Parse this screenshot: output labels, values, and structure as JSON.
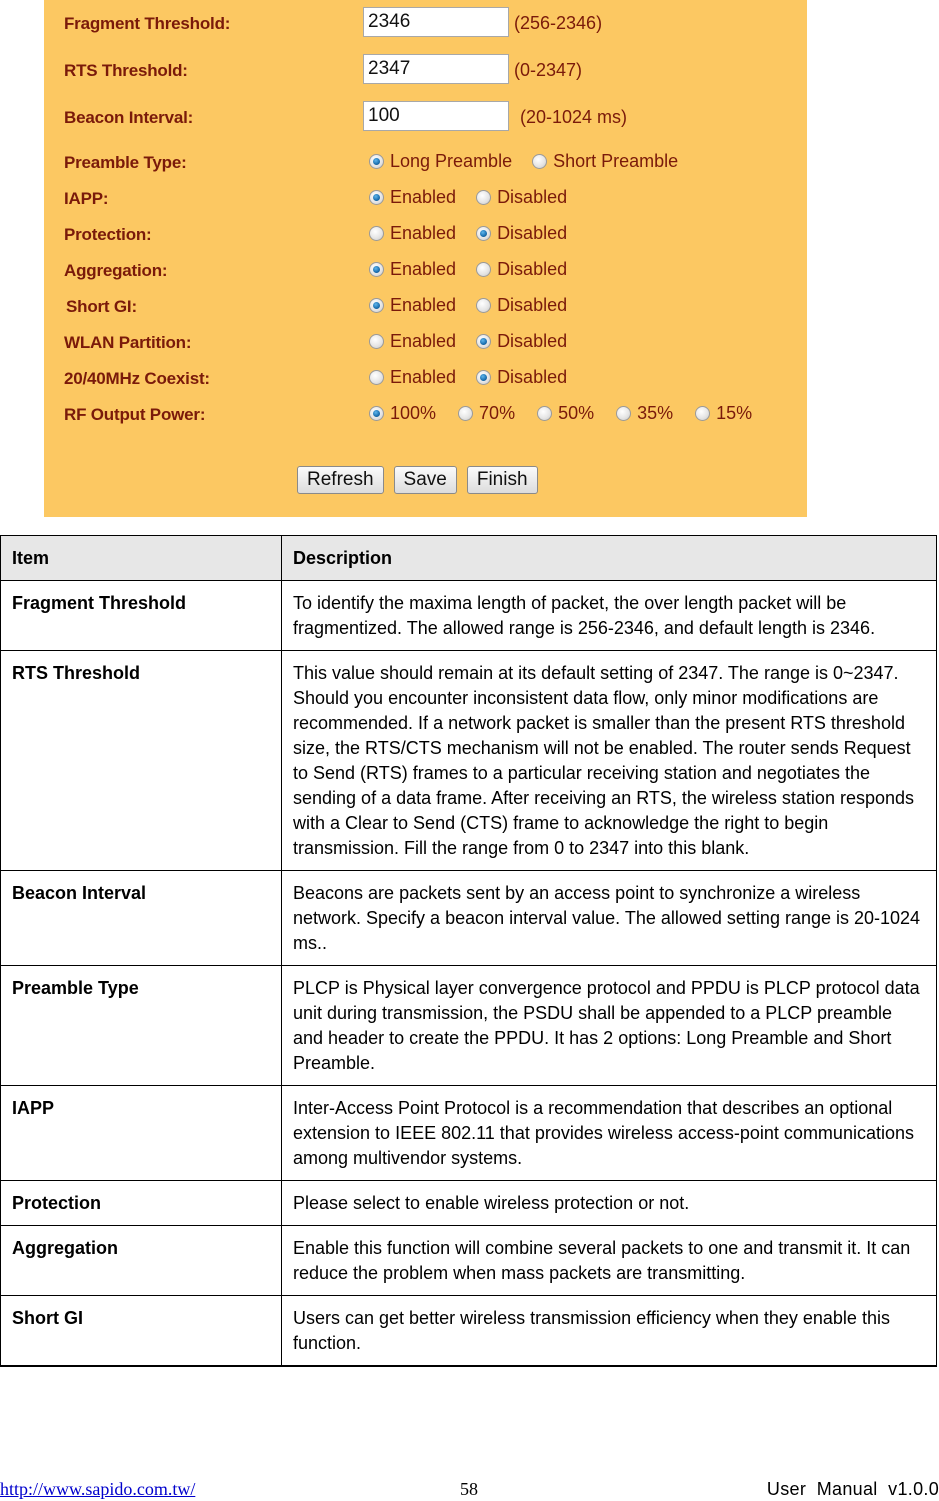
{
  "panel": {
    "background": "#fcc862",
    "text_fields": [
      {
        "label": "Fragment Threshold:",
        "value": "2346",
        "range": "(256-2346)"
      },
      {
        "label": "RTS Threshold:",
        "value": "2347",
        "range": "(0-2347)"
      },
      {
        "label": "Beacon Interval:",
        "value": "100",
        "range": "(20-1024 ms)"
      }
    ],
    "radio_groups": [
      {
        "label": "Preamble Type:",
        "options": [
          "Long Preamble",
          "Short Preamble"
        ],
        "selected": "Long Preamble"
      },
      {
        "label": "IAPP:",
        "options": [
          "Enabled",
          "Disabled"
        ],
        "selected": "Enabled"
      },
      {
        "label": "Protection:",
        "options": [
          "Enabled",
          "Disabled"
        ],
        "selected": "Disabled"
      },
      {
        "label": "Aggregation:",
        "options": [
          "Enabled",
          "Disabled"
        ],
        "selected": "Enabled"
      },
      {
        "label": "Short GI:",
        "options": [
          "Enabled",
          "Disabled"
        ],
        "selected": "Enabled"
      },
      {
        "label": "WLAN Partition:",
        "options": [
          "Enabled",
          "Disabled"
        ],
        "selected": "Disabled"
      },
      {
        "label": "20/40MHz Coexist:",
        "options": [
          "Enabled",
          "Disabled"
        ],
        "selected": "Disabled"
      },
      {
        "label": "RF Output Power:",
        "options": [
          "100%",
          "70%",
          "50%",
          "35%",
          "15%"
        ],
        "selected": "100%"
      }
    ],
    "buttons": {
      "refresh": "Refresh",
      "save": "Save",
      "finish": "Finish"
    }
  },
  "table": {
    "headers": [
      "Item",
      "Description"
    ],
    "rows": [
      {
        "item": "Fragment Threshold",
        "description": "To identify the maxima length of packet, the over length packet will be fragmentized. The allowed range is 256-2346, and default length is 2346."
      },
      {
        "item": "RTS Threshold",
        "description": "This value should remain at its default setting of 2347. The range is 0~2347. Should you encounter inconsistent data flow, only minor modifications are recommended. If a network packet is smaller than the present RTS threshold size, the RTS/CTS mechanism will not be enabled. The router sends Request to Send (RTS) frames to a particular receiving station and negotiates the sending of a data frame. After receiving an RTS, the wireless station responds with a Clear to Send (CTS) frame to acknowledge the right to begin transmission. Fill the range from 0 to 2347 into this blank."
      },
      {
        "item": "Beacon Interval",
        "description": "Beacons are packets sent by an access point to synchronize a wireless network. Specify a beacon interval value. The allowed setting range is 20-1024 ms.."
      },
      {
        "item": "Preamble Type",
        "description": "PLCP is Physical layer convergence protocol and PPDU is PLCP protocol data unit during transmission, the PSDU shall be appended to a PLCP preamble and header to create the PPDU. It has 2 options: Long Preamble and Short Preamble."
      },
      {
        "item": "IAPP",
        "description": "Inter-Access Point Protocol is a recommendation that describes an optional extension to IEEE 802.11 that provides wireless access-point communications among multivendor systems."
      },
      {
        "item": "Protection",
        "description": "Please select to enable wireless protection or not."
      },
      {
        "item": "Aggregation",
        "description": "Enable this function will combine several packets to one and transmit it. It can reduce the problem when mass packets are transmitting."
      },
      {
        "item": "Short GI",
        "description": "Users can get better wireless transmission efficiency when they enable this function."
      }
    ]
  },
  "footer": {
    "url": "http://www.sapido.com.tw/",
    "page_number": "58",
    "manual": "User  Manual  v1.0.0"
  }
}
